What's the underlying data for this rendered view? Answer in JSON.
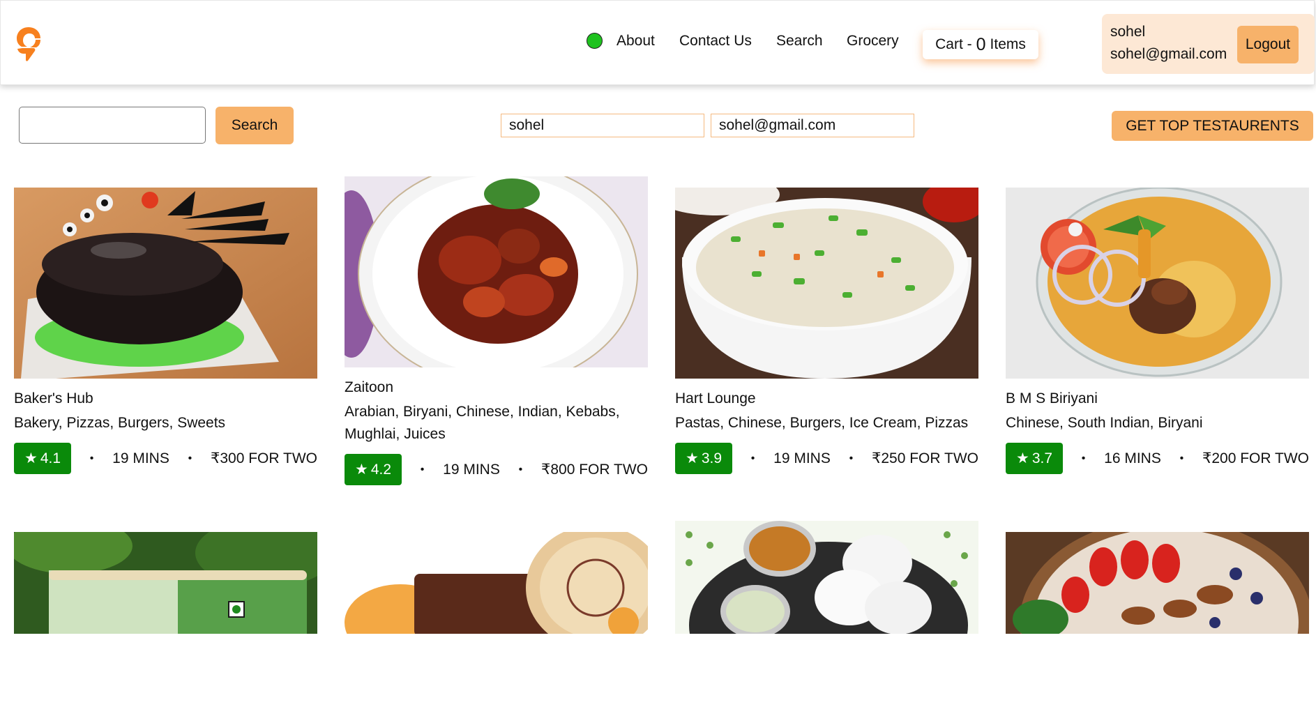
{
  "header": {
    "nav": [
      "About",
      "Contact Us",
      "Search",
      "Grocery"
    ],
    "cart": {
      "prefix": "Cart -",
      "count": "0",
      "suffix": "Items"
    },
    "user": {
      "name": "sohel",
      "email": "sohel@gmail.com",
      "logout_label": "Logout"
    },
    "online_status_color": "#1fc21f",
    "logo_icon": "swiggy-logo"
  },
  "toolbar": {
    "search_value": "",
    "search_label": "Search",
    "name_input_value": "sohel",
    "email_input_value": "sohel@gmail.com",
    "top_restaurants_label": "GET TOP TESTAURENTS"
  },
  "restaurants": [
    {
      "name": "Baker's Hub",
      "cuisines": "Bakery, Pizzas, Burgers, Sweets",
      "rating": "4.1",
      "time": "19 MINS",
      "cost": "₹300 FOR TWO"
    },
    {
      "name": "Zaitoon",
      "cuisines": "Arabian, Biryani, Chinese, Indian, Kebabs, Mughlai, Juices",
      "rating": "4.2",
      "time": "19 MINS",
      "cost": "₹800 FOR TWO"
    },
    {
      "name": "Hart Lounge",
      "cuisines": "Pastas, Chinese, Burgers, Ice Cream, Pizzas",
      "rating": "3.9",
      "time": "19 MINS",
      "cost": "₹250 FOR TWO"
    },
    {
      "name": "B M S Biriyani",
      "cuisines": "Chinese, South Indian, Biryani",
      "rating": "3.7",
      "time": "16 MINS",
      "cost": "₹200 FOR TWO"
    }
  ],
  "separator": "•",
  "colors": {
    "accent": "#f7b26a",
    "rating_bg": "#0a8a0a",
    "brand": "#f7801e"
  }
}
